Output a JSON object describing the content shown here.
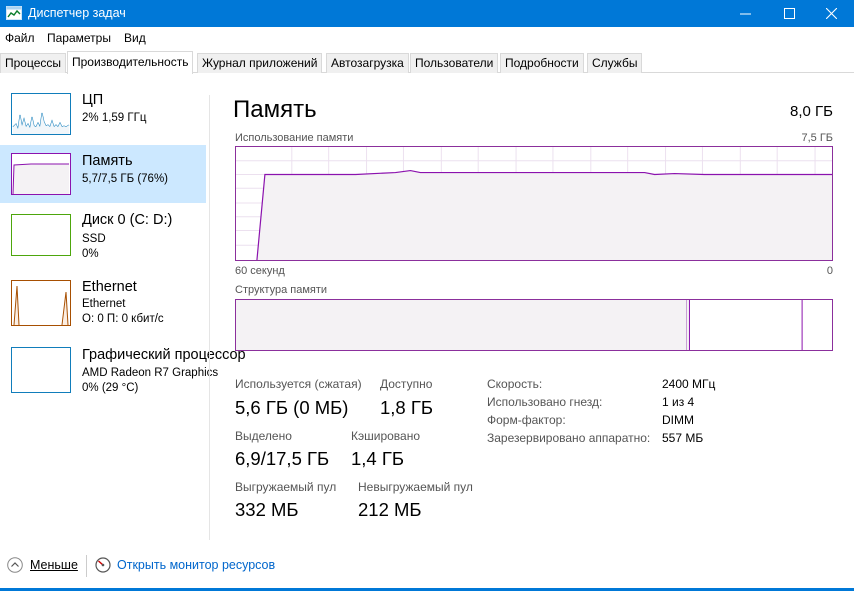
{
  "window": {
    "title": "Диспетчер задач"
  },
  "menu": [
    "Файл",
    "Параметры",
    "Вид"
  ],
  "tabs": [
    {
      "label": "Процессы"
    },
    {
      "label": "Производительность"
    },
    {
      "label": "Журнал приложений"
    },
    {
      "label": "Автозагрузка"
    },
    {
      "label": "Пользователи"
    },
    {
      "label": "Подробности"
    },
    {
      "label": "Службы"
    }
  ],
  "active_tab": "Производительность",
  "sidebar": [
    {
      "name": "ЦП",
      "line1": "2% 1,59 ГГц",
      "line2": "",
      "color": "#117dbb"
    },
    {
      "name": "Память",
      "line1": "5,7/7,5 ГБ (76%)",
      "line2": "",
      "color": "#8b12ae"
    },
    {
      "name": "Диск 0 (C: D:)",
      "line1": "SSD",
      "line2": "0%",
      "color": "#4da60c"
    },
    {
      "name": "Ethernet",
      "line1": "Ethernet",
      "line2": "О: 0 П: 0 кбит/с",
      "color": "#a74f01"
    },
    {
      "name": "Графический процессор",
      "line1": "AMD Radeon R7 Graphics",
      "line2": "0% (29 °C)",
      "color": "#117dbb"
    }
  ],
  "main": {
    "title": "Память",
    "total": "8,0 ГБ",
    "usage_label": "Использование памяти",
    "usage_max": "7,5 ГБ",
    "time_left": "60 секунд",
    "time_right": "0",
    "structure_label": "Структура памяти",
    "usage_fraction": 0.76,
    "accent": "#8b12ae"
  },
  "stats": {
    "in_use_label": "Используется (сжатая)",
    "in_use_value": "5,6 ГБ (0 МБ)",
    "available_label": "Доступно",
    "available_value": "1,8 ГБ",
    "committed_label": "Выделено",
    "committed_value": "6,9/17,5 ГБ",
    "cached_label": "Кэшировано",
    "cached_value": "1,4 ГБ",
    "paged_label": "Выгружаемый пул",
    "paged_value": "332 МБ",
    "nonpaged_label": "Невыгружаемый пул",
    "nonpaged_value": "212 МБ"
  },
  "details": [
    {
      "key": "Скорость:",
      "value": "2400 МГц"
    },
    {
      "key": "Использовано гнезд:",
      "value": "1 из 4"
    },
    {
      "key": "Форм-фактор:",
      "value": "DIMM"
    },
    {
      "key": "Зарезервировано аппаратно:",
      "value": "557 МБ"
    }
  ],
  "footer": {
    "fewer_label": "Меньше",
    "monitor_label": "Открыть монитор ресурсов"
  }
}
